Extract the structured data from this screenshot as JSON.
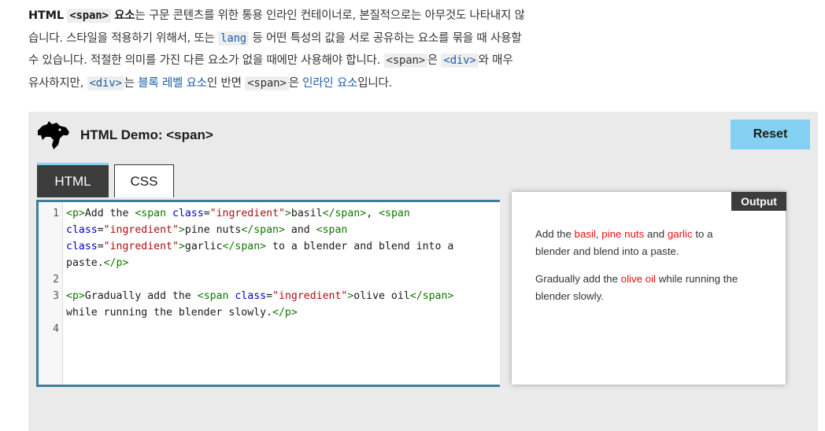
{
  "intro": {
    "line1": {
      "title_html": "HTML",
      "code_span": "<span>",
      "title_element": "요소",
      "text": "는 구문 콘텐츠를 위한 통용 인라인 컨테이너로, 본질적으로는 아무것도 나타내지 않"
    },
    "line2": {
      "text_a": "습니다. 스타일을 적용하기 위해서, 또는",
      "code_lang": "lang",
      "text_b": "등 어떤 특성의 값을 서로 공유하는 요소를 묶을 때 사용할"
    },
    "line3": {
      "text_a": "수 있습니다. 적절한 의미를 가진 다른 요소가 없을 때에만 사용해야 합니다.",
      "code_span": "<span>",
      "text_b": "은",
      "code_div": "<div>",
      "text_c": "와 매우"
    },
    "line4": {
      "text_a": "유사하지만,",
      "code_div": "<div>",
      "text_b": "는",
      "link_block": "블록 레벨 요소",
      "text_c": "인 반면",
      "code_span": "<span>",
      "text_d": "은",
      "link_inline": "인라인 요소",
      "text_e": "입니다."
    }
  },
  "demo": {
    "title": "HTML Demo: <span>",
    "reset_label": "Reset",
    "tabs": [
      {
        "label": "HTML",
        "active": true
      },
      {
        "label": "CSS",
        "active": false
      }
    ],
    "line_numbers": [
      "1",
      "",
      "",
      "",
      "2",
      "3",
      "",
      "4"
    ],
    "output_label": "Output",
    "output": {
      "p1": {
        "pre": "Add the ",
        "ing1": "basil",
        "sep1": ", ",
        "ing2": "pine nuts",
        "sep2": " and ",
        "ing3": "garlic",
        "post": " to a blender and blend into a paste."
      },
      "p2": {
        "pre": "Gradually add the ",
        "ing1": "olive oil",
        "post": " while running the blender slowly."
      }
    },
    "colors": {
      "accent": "#83d0f2",
      "editor_border": "#3d7e9a",
      "tab_active_bg": "#3c3c3c",
      "ingredient": "#ee1111"
    }
  }
}
